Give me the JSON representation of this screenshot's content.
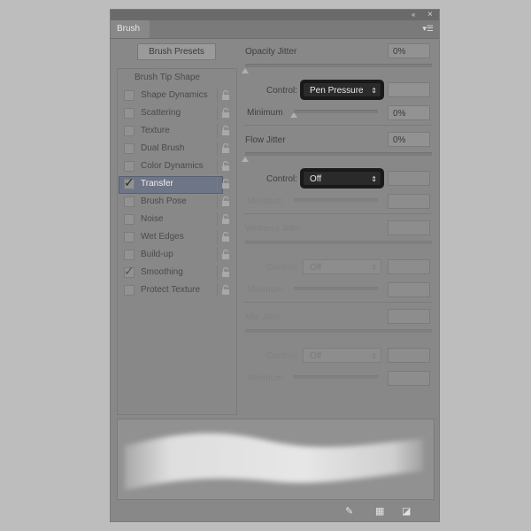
{
  "panel": {
    "tab_label": "Brush",
    "collapse_icon": "«",
    "close_icon": "×",
    "menu_icon": "▾☰"
  },
  "presets_button": "Brush Presets",
  "left_list": {
    "header": "Brush Tip Shape",
    "items": [
      {
        "label": "Shape Dynamics",
        "checked": false,
        "selected": false
      },
      {
        "label": "Scattering",
        "checked": false,
        "selected": false
      },
      {
        "label": "Texture",
        "checked": false,
        "selected": false
      },
      {
        "label": "Dual Brush",
        "checked": false,
        "selected": false
      },
      {
        "label": "Color Dynamics",
        "checked": false,
        "selected": false
      },
      {
        "label": "Transfer",
        "checked": true,
        "selected": true
      },
      {
        "label": "Brush Pose",
        "checked": false,
        "selected": false
      },
      {
        "label": "Noise",
        "checked": false,
        "selected": false
      },
      {
        "label": "Wet Edges",
        "checked": false,
        "selected": false
      },
      {
        "label": "Build-up",
        "checked": false,
        "selected": false
      },
      {
        "label": "Smoothing",
        "checked": true,
        "selected": false
      },
      {
        "label": "Protect Texture",
        "checked": false,
        "selected": false
      }
    ]
  },
  "check_glyph": "✓",
  "lock_glyph": "🔓",
  "control_label": "Control:",
  "minimum_label": "Minimum",
  "opacity": {
    "label": "Opacity Jitter",
    "value": "0%",
    "control": "Pen Pressure",
    "minimum": "0%"
  },
  "flow": {
    "label": "Flow Jitter",
    "value": "0%",
    "control": "Off"
  },
  "wetness": {
    "label": "Wetness Jitter",
    "control": "Off"
  },
  "mix": {
    "label": "Mix Jitter",
    "control": "Off"
  },
  "select_arrow": "⇕"
}
